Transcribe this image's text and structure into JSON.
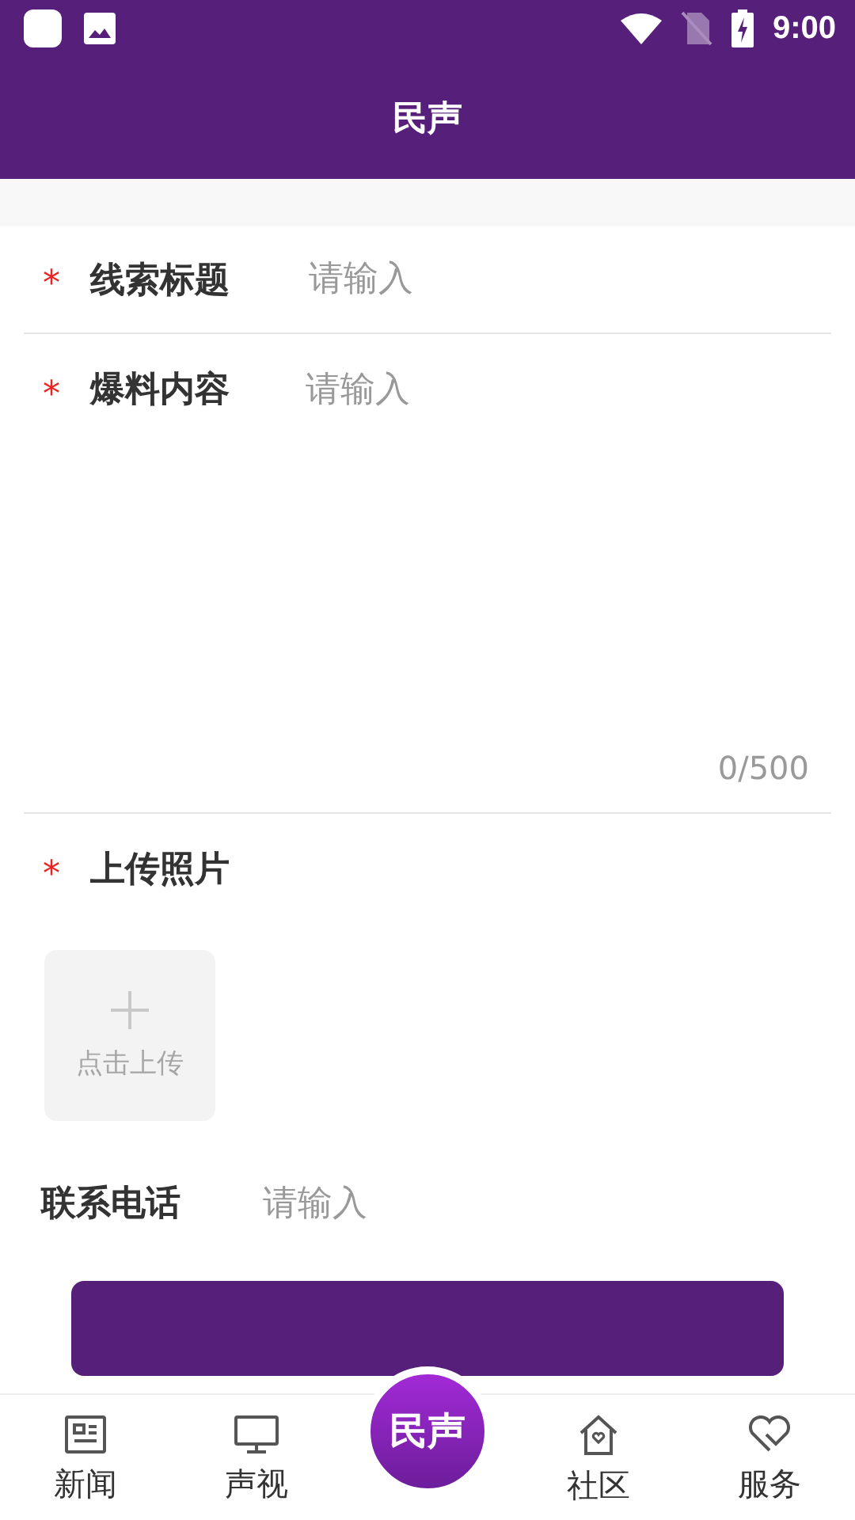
{
  "status_bar": {
    "time": "9:00"
  },
  "header": {
    "title": "民声"
  },
  "form": {
    "title_field": {
      "required_mark": "*",
      "label": "线索标题",
      "placeholder": "请输入"
    },
    "content_field": {
      "required_mark": "*",
      "label": "爆料内容",
      "placeholder": "请输入",
      "counter": "0/500"
    },
    "upload": {
      "required_mark": "*",
      "label": "上传照片",
      "button_label": "点击上传"
    },
    "phone_field": {
      "label": "联系电话",
      "placeholder": "请输入"
    }
  },
  "tab_bar": {
    "items": [
      {
        "label": "新闻",
        "kind": "news"
      },
      {
        "label": "声视",
        "kind": "tv"
      },
      {
        "label": "民声",
        "kind": "logo"
      },
      {
        "label": "社区",
        "kind": "home"
      },
      {
        "label": "服务",
        "kind": "heart"
      }
    ]
  }
}
